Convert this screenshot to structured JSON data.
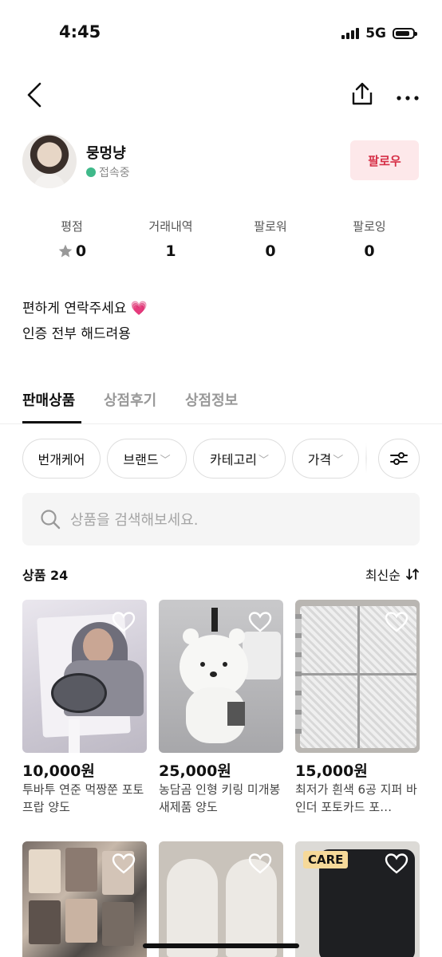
{
  "status_bar": {
    "time": "4:45",
    "network": "5G"
  },
  "nav": {
    "back_icon": "chevron-left-icon",
    "share_icon": "share-icon",
    "more_icon": "more-icon"
  },
  "profile": {
    "nickname": "뭉멍냥",
    "online_status": "접속중",
    "follow_label": "팔로우"
  },
  "stats": [
    {
      "label": "평점",
      "value": "0"
    },
    {
      "label": "거래내역",
      "value": "1"
    },
    {
      "label": "팔로워",
      "value": "0"
    },
    {
      "label": "팔로잉",
      "value": "0"
    }
  ],
  "intro": {
    "line1": "편하게 연락주세요 💗",
    "line2": "인증 전부 해드려용"
  },
  "tabs": [
    "판매상품",
    "상점후기",
    "상점정보"
  ],
  "filters": [
    "번개케어",
    "브랜드",
    "카테고리",
    "가격"
  ],
  "search": {
    "placeholder": "상품을 검색해보세요."
  },
  "products_header": {
    "count_label": "상품 24",
    "sort_label": "최신순"
  },
  "products": [
    {
      "price": "10,000원",
      "title": "투바투 연준 먹짱쭌 포토프랍 양도"
    },
    {
      "price": "25,000원",
      "title": "농담곰 인형 키링 미개봉 새제품 양도"
    },
    {
      "price": "15,000원",
      "title": "최저가 흰색 6공 지퍼 바인더 포토카드 포…"
    }
  ],
  "partial_products": [
    {
      "tag": ""
    },
    {
      "tag": ""
    },
    {
      "tag": "CARE"
    }
  ],
  "colors": {
    "accent": "#d62f47",
    "follow_bg": "#fde8ea",
    "online": "#3fb98a"
  }
}
